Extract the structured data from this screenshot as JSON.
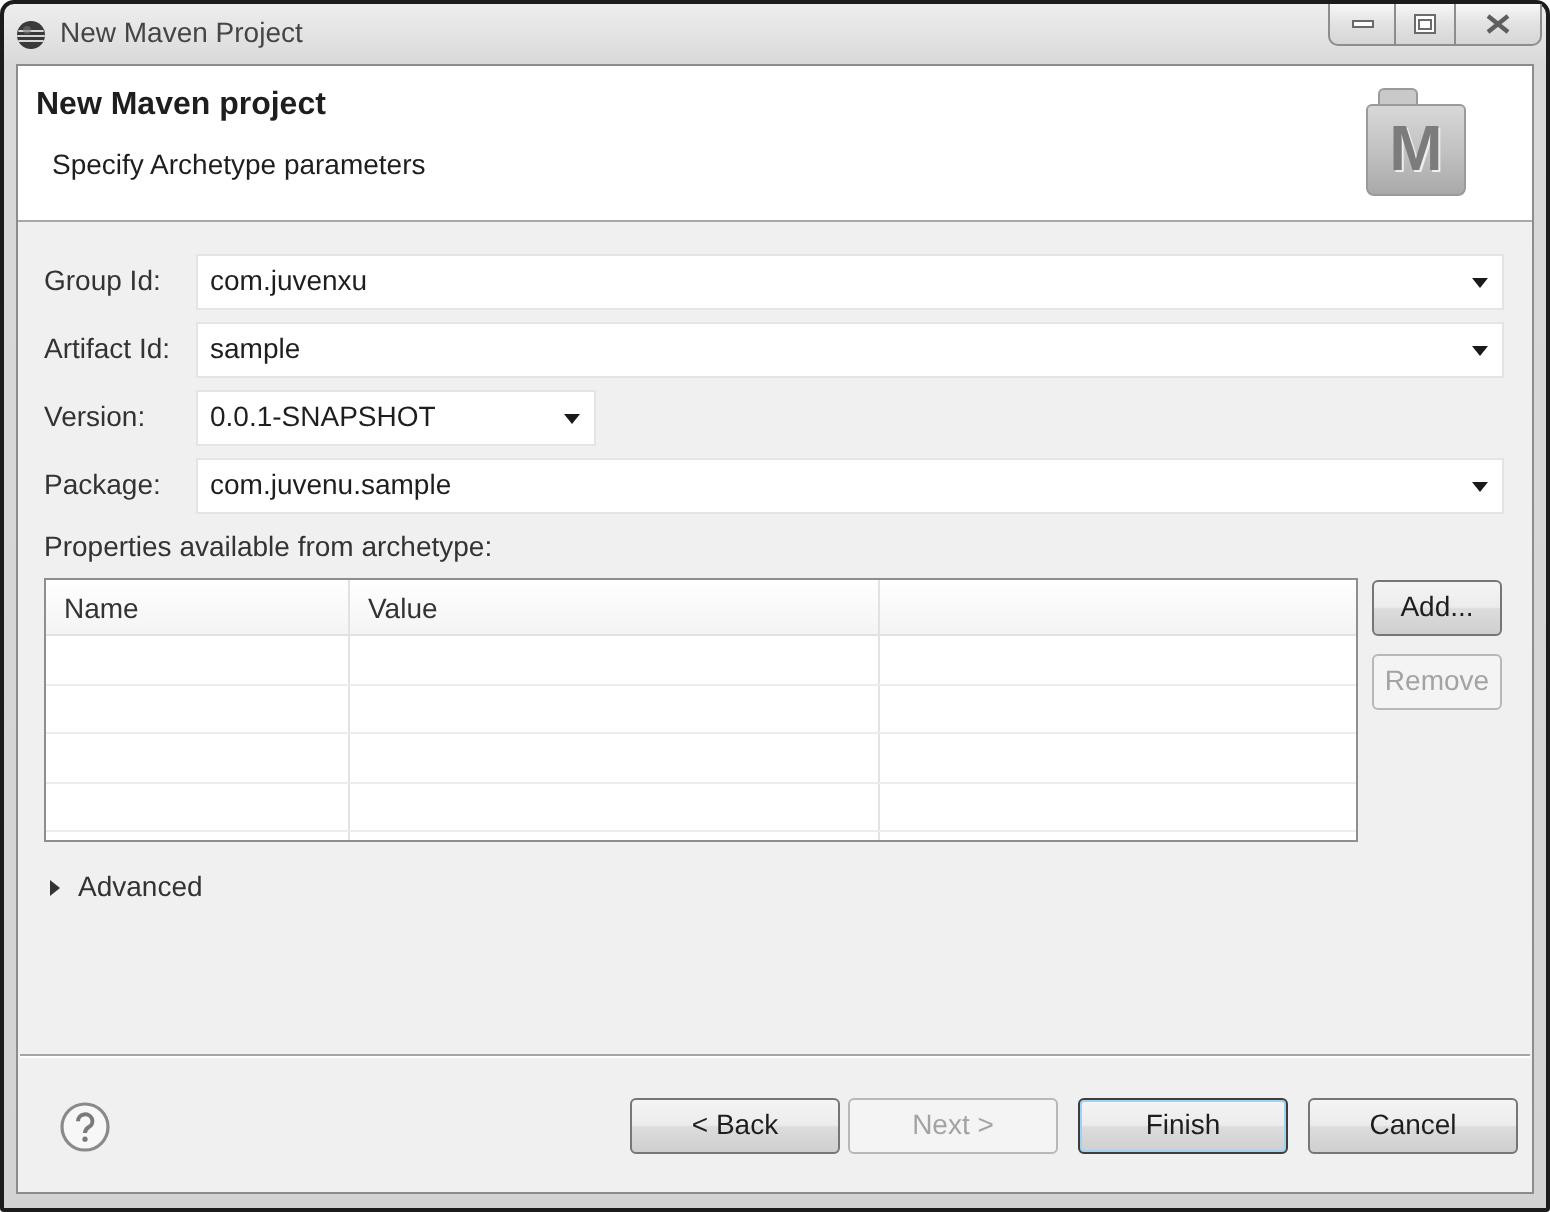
{
  "window": {
    "title": "New Maven Project"
  },
  "header": {
    "title": "New Maven project",
    "description": "Specify Archetype parameters",
    "logo": "M"
  },
  "fields": [
    {
      "label": "Group Id:",
      "value": "com.juvenxu"
    },
    {
      "label": "Artifact Id:",
      "value": "sample"
    },
    {
      "label": "Version:",
      "value": "0.0.1-SNAPSHOT"
    },
    {
      "label": "Package:",
      "value": "com.juvenu.sample"
    }
  ],
  "properties": {
    "label": "Properties available from archetype:",
    "columns": [
      "Name",
      "Value"
    ],
    "buttons": [
      {
        "label": "Add...",
        "disabled": false
      },
      {
        "label": "Remove",
        "disabled": true
      }
    ]
  },
  "advanced": {
    "label": "Advanced",
    "expanded": false
  },
  "footer": {
    "buttons": [
      {
        "label": "< Back",
        "disabled": false,
        "default": false
      },
      {
        "label": "Next >",
        "disabled": true,
        "default": false
      },
      {
        "label": "Finish",
        "disabled": false,
        "default": true
      },
      {
        "label": "Cancel",
        "disabled": false,
        "default": false
      }
    ]
  }
}
